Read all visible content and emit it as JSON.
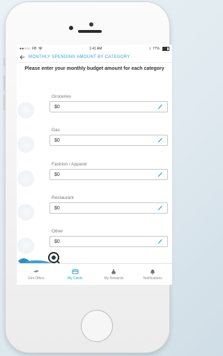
{
  "status_bar": {
    "carrier": "FB",
    "time": "1:41 AM",
    "battery": "77%"
  },
  "nav": {
    "title": "MONTHLY SPENDING AMOUNT BY CATEGORY"
  },
  "instruction": "Please enter your monthly budget amount for each category",
  "categories": [
    {
      "label": "Groceries",
      "value": "$0",
      "icon": "groceries-icon"
    },
    {
      "label": "Gas",
      "value": "$0",
      "icon": "gas-icon"
    },
    {
      "label": "Fashion / Apparel",
      "value": "$0",
      "icon": "fashion-icon"
    },
    {
      "label": "Restaurant",
      "value": "$0",
      "icon": "restaurant-icon"
    },
    {
      "label": "Other",
      "value": "$0",
      "icon": "other-icon"
    }
  ],
  "tabs": [
    {
      "label": "Gini Offers",
      "icon": "gini-offers-icon",
      "active": false
    },
    {
      "label": "My Cards",
      "icon": "card-icon",
      "active": true
    },
    {
      "label": "My Rewards",
      "icon": "money-bag-icon",
      "active": false
    },
    {
      "label": "Notifications",
      "icon": "bell-icon",
      "active": false
    }
  ],
  "colors": {
    "accent": "#2aa3cf",
    "mascot": "#3aa3d3"
  }
}
